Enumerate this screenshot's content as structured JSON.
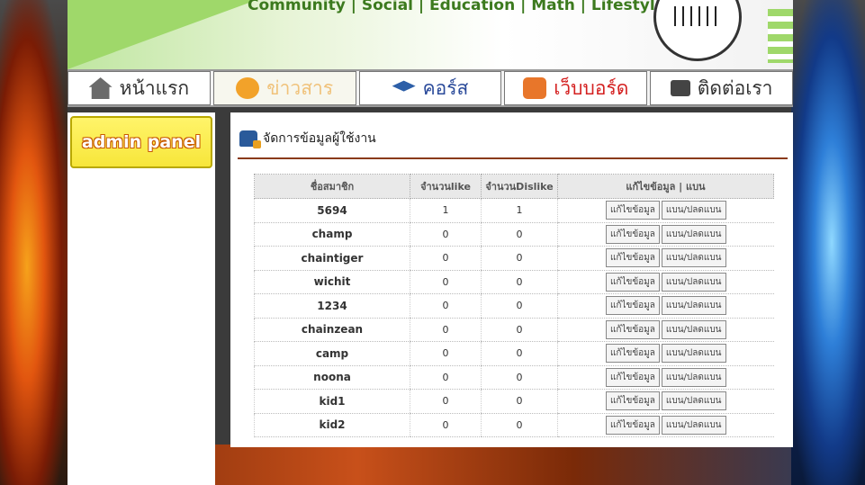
{
  "banner": {
    "tagline": "Community | Social | Education | Math | Lifestyle"
  },
  "nav": [
    {
      "label": "หน้าแรก",
      "icon": "home-icon"
    },
    {
      "label": "ข่าวสาร",
      "icon": "rss-icon"
    },
    {
      "label": "คอร์ส",
      "icon": "graduation-cap-icon"
    },
    {
      "label": "เว็บบอร์ด",
      "icon": "chat-bubbles-icon"
    },
    {
      "label": "ติดต่อเรา",
      "icon": "message-icon"
    }
  ],
  "sidebar": {
    "admin_panel_label": "admin panel"
  },
  "panel": {
    "title": "จัดการข้อมูลผู้ใช้งาน",
    "table": {
      "headers": [
        "ชื่อสมาชิก",
        "จำนวนlike",
        "จำนวนDislike",
        "แก้ไขข้อมูล | แบน"
      ],
      "edit_label": "แก้ไขข้อมูล",
      "ban_label": "แบน/ปลดแบน",
      "rows": [
        {
          "name": "5694",
          "likes": "1",
          "dislikes": "1"
        },
        {
          "name": "champ",
          "likes": "0",
          "dislikes": "0"
        },
        {
          "name": "chaintiger",
          "likes": "0",
          "dislikes": "0"
        },
        {
          "name": "wichit",
          "likes": "0",
          "dislikes": "0"
        },
        {
          "name": "1234",
          "likes": "0",
          "dislikes": "0"
        },
        {
          "name": "chainzean",
          "likes": "0",
          "dislikes": "0"
        },
        {
          "name": "camp",
          "likes": "0",
          "dislikes": "0"
        },
        {
          "name": "noona",
          "likes": "0",
          "dislikes": "0"
        },
        {
          "name": "kid1",
          "likes": "0",
          "dislikes": "0"
        },
        {
          "name": "kid2",
          "likes": "0",
          "dislikes": "0"
        }
      ]
    }
  },
  "colors": {
    "accent_green": "#9fd86a",
    "admin_yellow": "#f7e63a",
    "divider_brown": "#8a3a1a"
  }
}
